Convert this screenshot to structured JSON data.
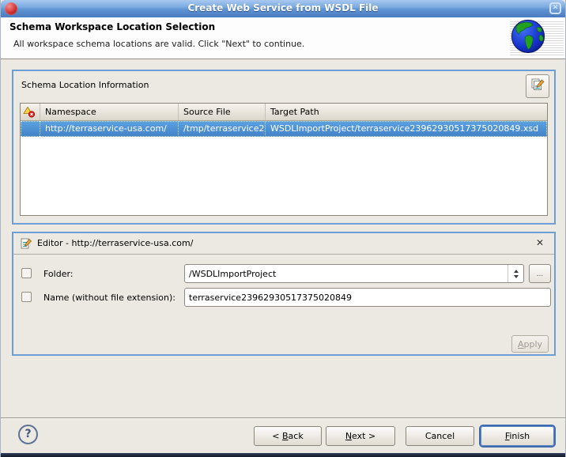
{
  "window": {
    "title": "Create Web Service from WSDL File",
    "close_glyph": "✕"
  },
  "header": {
    "title": "Schema Workspace Location Selection",
    "description": "All workspace schema locations are valid. Click \"Next\" to continue."
  },
  "schema_group": {
    "title": "Schema Location Information",
    "edit_button_icon": "edit-schema-icon",
    "table": {
      "columns": [
        "status-icon",
        "Namespace",
        "Source File",
        "Target Path"
      ],
      "rows": [
        {
          "selected": true,
          "namespace": "http://terraservice-usa.com/",
          "source_file": "/tmp/terraservice2",
          "target_path": "WSDLImportProject/terraservice23962930517375020849.xsd"
        }
      ]
    }
  },
  "editor_group": {
    "title": "Editor - http://terraservice-usa.com/",
    "close_glyph": "✕",
    "rows": {
      "folder": {
        "label": "Folder:",
        "value": "/WSDLImportProject",
        "checked": false
      },
      "name": {
        "label": "Name (without file extension):",
        "value": "terraservice23962930517375020849",
        "checked": false
      }
    },
    "browse_label": "...",
    "apply": {
      "pre": "",
      "key": "A",
      "post": "pply",
      "enabled": false
    }
  },
  "footer": {
    "help_glyph": "?",
    "back": {
      "pre": "< ",
      "key": "B",
      "post": "ack"
    },
    "next": {
      "pre": "",
      "key": "N",
      "post": "ext >"
    },
    "cancel": {
      "pre": "",
      "key": "",
      "post": "Cancel"
    },
    "finish": {
      "pre": "",
      "key": "F",
      "post": "inish",
      "default": true
    }
  },
  "icons": {
    "app": "red-sphere-icon",
    "banner": "globe-icon",
    "status_column": "warning-error-icon",
    "editor_header": "edit-page-icon",
    "combo": "spinner-arrows-icon",
    "help": "question-mark-icon"
  },
  "colors": {
    "background": "#ece9e2",
    "banner_background": "#fdfdfd",
    "titlebar_blue": "#5f93d2",
    "group_border": "#6b9fd6",
    "selection_blue": "#4282c6",
    "default_button_ring": "#3e6cb0"
  }
}
